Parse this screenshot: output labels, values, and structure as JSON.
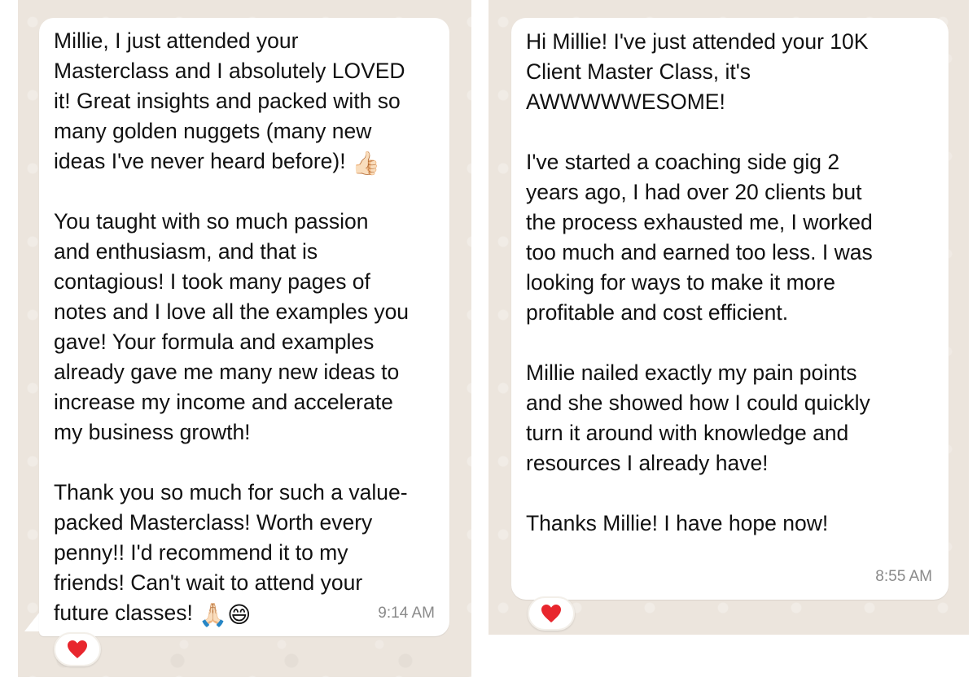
{
  "left_message": {
    "paragraphs": [
      "Millie, I just attended your\nMasterclass and I absolutely LOVED\nit! Great insights and packed with so\nmany golden nuggets (many new\nideas I've never heard before)! ",
      "You taught with so much passion\nand enthusiasm, and that is\ncontagious! I took many pages of\nnotes and I love all the examples you\ngave! Your formula and examples\nalready gave me many new ideas to\nincrease my income and accelerate\nmy business growth!",
      "Thank you so much for such a value-\npacked Masterclass! Worth every\npenny!! I'd recommend it to my\nfriends! Can't wait to attend your\nfuture classes! "
    ],
    "emoji_thumbs": "👍🏻",
    "emoji_end": "🙏🏻😄",
    "time": "9:14 AM",
    "reaction": "❤️"
  },
  "right_message": {
    "paragraphs": [
      "Hi Millie! I've just attended your 10K\nClient Master Class, it's\nAWWWWWESOME!",
      "I've started a coaching side gig 2\nyears ago, I had over 20 clients but\nthe process exhausted me, I worked\ntoo much and earned too less. I was\nlooking for ways to make it more\nprofitable and cost efficient.",
      "Millie nailed exactly my pain points\nand she showed how I could quickly\nturn it around with knowledge and\nresources I already have!",
      "Thanks Millie! I have hope now!"
    ],
    "time": "8:55 AM",
    "reaction": "❤️"
  },
  "colors": {
    "chat_background": "#ece5dd",
    "bubble": "#ffffff",
    "heart": "#e8262d",
    "timestamp": "#8a8a8a"
  }
}
